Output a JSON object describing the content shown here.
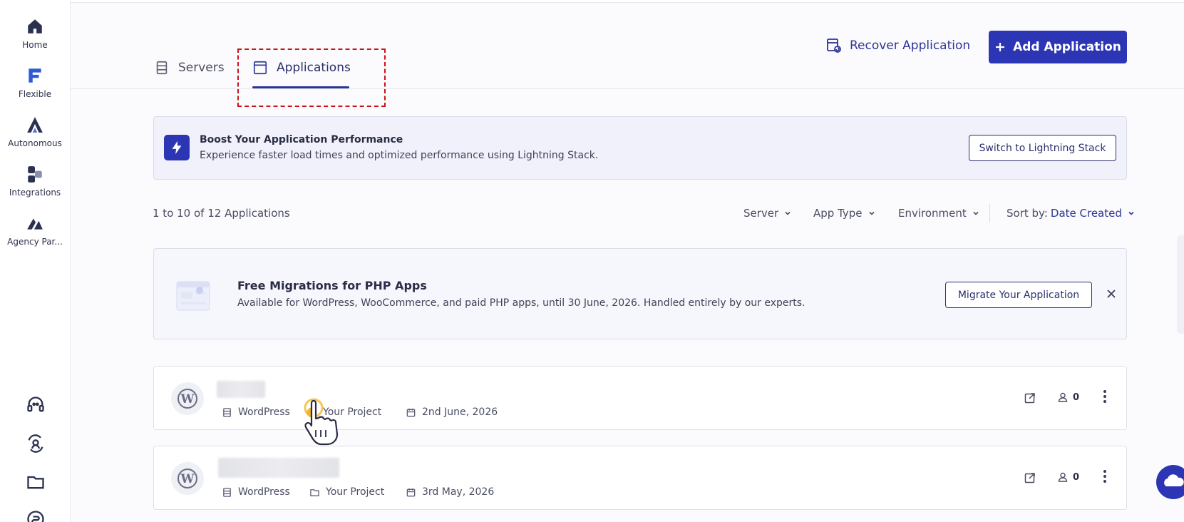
{
  "rail": {
    "items": [
      {
        "label": "Home",
        "icon": "home-icon"
      },
      {
        "label": "Flexible",
        "icon": "flexible-icon"
      },
      {
        "label": "Autonomous",
        "icon": "autonomous-icon"
      },
      {
        "label": "Integrations",
        "icon": "integrations-icon"
      },
      {
        "label": "Agency Par...",
        "icon": "agency-partner-icon"
      }
    ],
    "bottom_icons": [
      "support-icon",
      "user-switch-icon",
      "folder-icon",
      "billing-icon"
    ]
  },
  "tabs": [
    {
      "label": "Servers",
      "active": false
    },
    {
      "label": "Applications",
      "active": true
    }
  ],
  "header": {
    "recover_label": "Recover Application",
    "add_label": "Add Application"
  },
  "boost": {
    "title": "Boost Your Application Performance",
    "subtitle": "Experience faster load times and optimized performance using Lightning Stack.",
    "button": "Switch to Lightning Stack"
  },
  "filters": {
    "count": "1 to 10 of 12 Applications",
    "server": "Server",
    "app_type": "App Type",
    "environment": "Environment",
    "sort_label": "Sort by:",
    "sort_value": "Date Created"
  },
  "migration": {
    "title": "Free Migrations for PHP Apps",
    "subtitle": "Available for WordPress, WooCommerce, and paid PHP apps, until 30 June, 2026. Handled entirely by our experts.",
    "button": "Migrate Your Application"
  },
  "apps": [
    {
      "name": "",
      "type": "WordPress",
      "project": "Your Project",
      "date": "2nd June, 2026",
      "users": "0"
    },
    {
      "name": "",
      "type": "WordPress",
      "project": "Your Project",
      "date": "3rd May, 2026",
      "users": "0"
    }
  ],
  "colors": {
    "primary": "#2c36b5",
    "accent_text": "#2e3596",
    "highlight": "#c8141a"
  }
}
